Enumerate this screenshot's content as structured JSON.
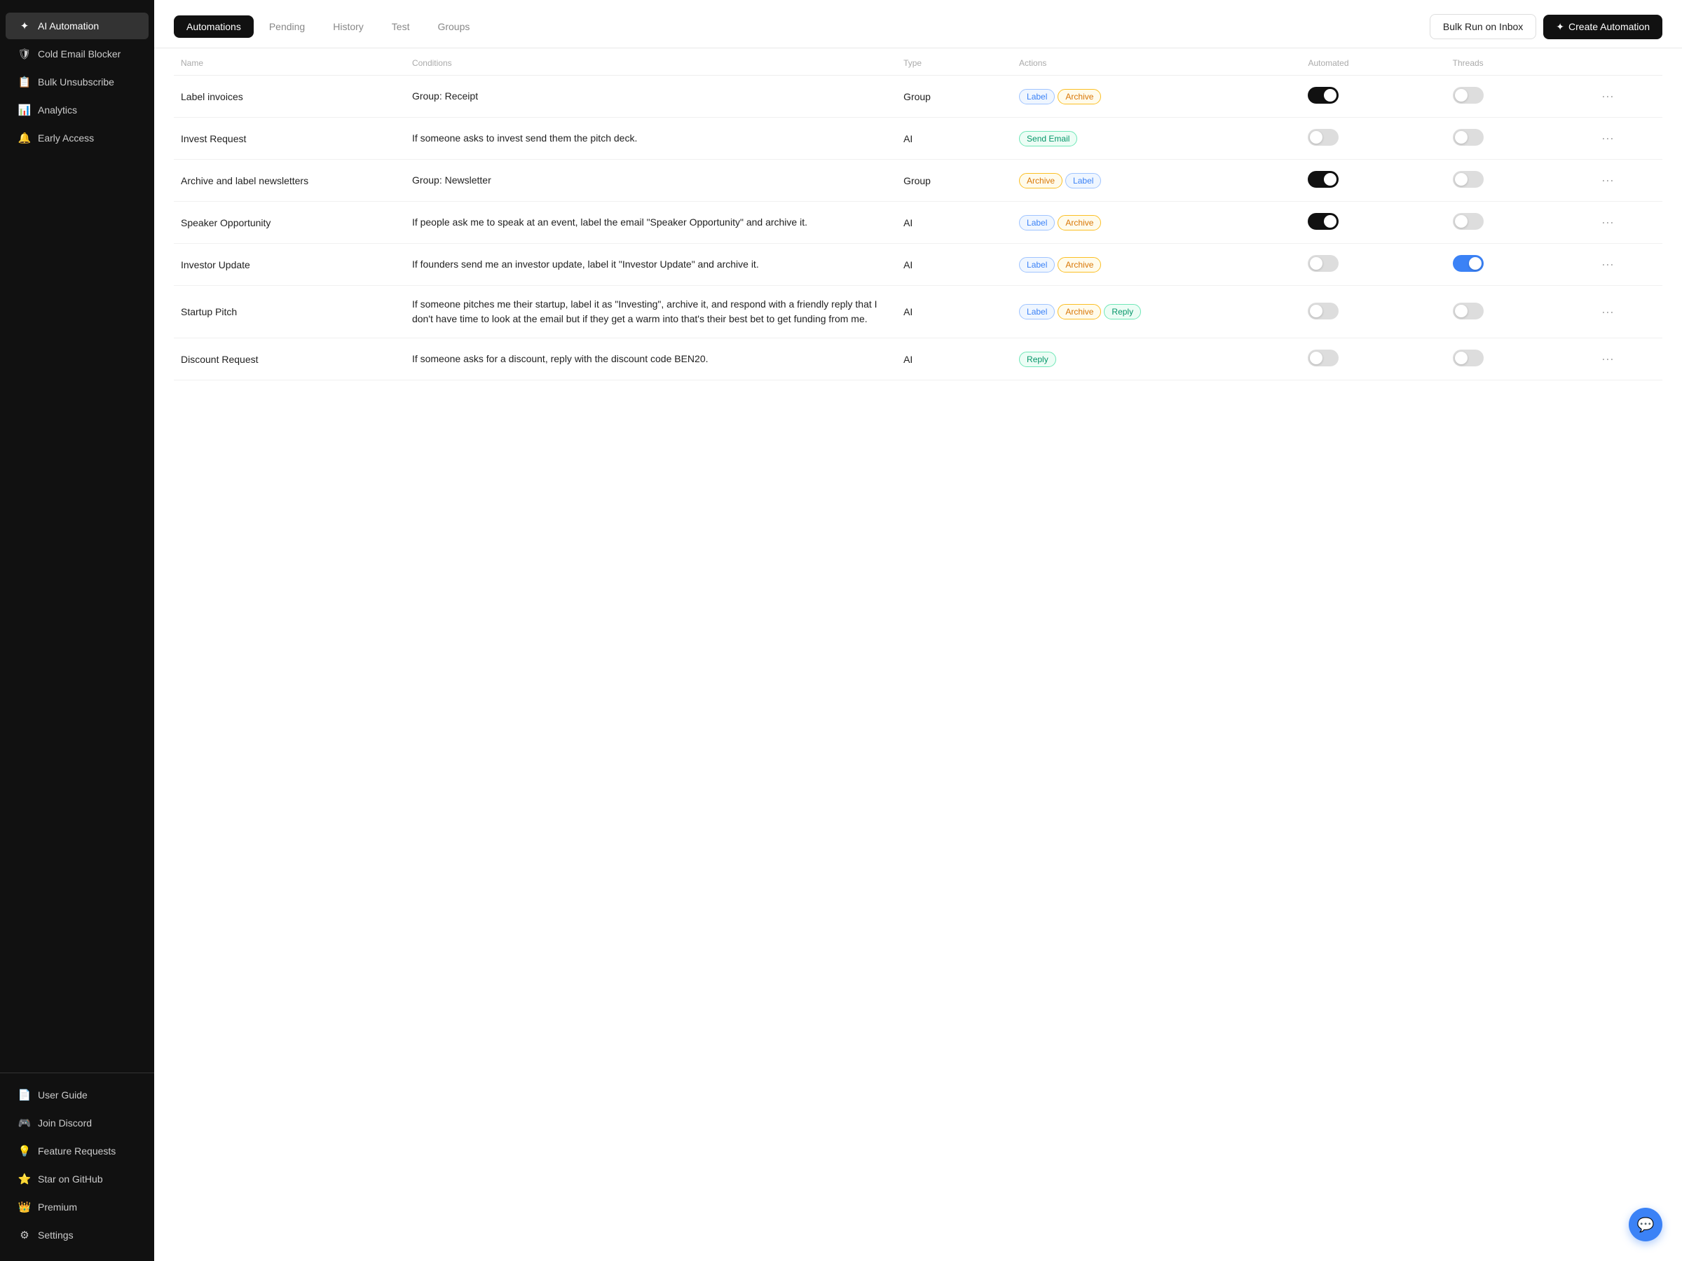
{
  "sidebar": {
    "items": [
      {
        "id": "ai-automation",
        "label": "AI Automation",
        "icon": "✦",
        "active": true
      },
      {
        "id": "cold-email-blocker",
        "label": "Cold Email Blocker",
        "icon": "🛡"
      },
      {
        "id": "bulk-unsubscribe",
        "label": "Bulk Unsubscribe",
        "icon": "📋"
      },
      {
        "id": "analytics",
        "label": "Analytics",
        "icon": "📊"
      },
      {
        "id": "early-access",
        "label": "Early Access",
        "icon": "🔔"
      }
    ],
    "bottom_items": [
      {
        "id": "user-guide",
        "label": "User Guide",
        "icon": "📄"
      },
      {
        "id": "join-discord",
        "label": "Join Discord",
        "icon": "🎮"
      },
      {
        "id": "feature-requests",
        "label": "Feature Requests",
        "icon": "💡"
      },
      {
        "id": "star-github",
        "label": "Star on GitHub",
        "icon": "⭐"
      },
      {
        "id": "premium",
        "label": "Premium",
        "icon": "👑"
      },
      {
        "id": "settings",
        "label": "Settings",
        "icon": "⚙"
      }
    ]
  },
  "tabs": [
    "Automations",
    "Pending",
    "History",
    "Test",
    "Groups"
  ],
  "active_tab": "Automations",
  "buttons": {
    "bulk_run": "Bulk Run on Inbox",
    "create": "Create Automation"
  },
  "table": {
    "headers": [
      "Name",
      "Conditions",
      "Type",
      "Actions",
      "Automated",
      "Threads"
    ],
    "rows": [
      {
        "name": "Label invoices",
        "conditions": "Group: Receipt",
        "type": "Group",
        "actions": [
          {
            "label": "Label",
            "type": "label"
          },
          {
            "label": "Archive",
            "type": "archive"
          }
        ],
        "automated_on": true,
        "threads_on": false
      },
      {
        "name": "Invest Request",
        "conditions": "If someone asks to invest send them the pitch deck.",
        "type": "AI",
        "actions": [
          {
            "label": "Send Email",
            "type": "send-email"
          }
        ],
        "automated_on": false,
        "threads_on": false
      },
      {
        "name": "Archive and label newsletters",
        "conditions": "Group: Newsletter",
        "type": "Group",
        "actions": [
          {
            "label": "Archive",
            "type": "archive"
          },
          {
            "label": "Label",
            "type": "label"
          }
        ],
        "automated_on": true,
        "threads_on": false
      },
      {
        "name": "Speaker Opportunity",
        "conditions": "If people ask me to speak at an event, label the email \"Speaker Opportunity\" and archive it.",
        "type": "AI",
        "actions": [
          {
            "label": "Label",
            "type": "label"
          },
          {
            "label": "Archive",
            "type": "archive"
          }
        ],
        "automated_on": true,
        "threads_on": false
      },
      {
        "name": "Investor Update",
        "conditions": "If founders send me an investor update, label it \"Investor Update\" and archive it.",
        "type": "AI",
        "actions": [
          {
            "label": "Label",
            "type": "label"
          },
          {
            "label": "Archive",
            "type": "archive"
          }
        ],
        "automated_on": false,
        "threads_on": true
      },
      {
        "name": "Startup Pitch",
        "conditions": "If someone pitches me their startup, label it as \"Investing\", archive it, and respond with a friendly reply that I don't have time to look at the email but if they get a warm into that's their best bet to get funding from me.",
        "type": "AI",
        "actions": [
          {
            "label": "Label",
            "type": "label"
          },
          {
            "label": "Archive",
            "type": "archive"
          },
          {
            "label": "Reply",
            "type": "reply"
          }
        ],
        "automated_on": false,
        "threads_on": false
      },
      {
        "name": "Discount Request",
        "conditions": "If someone asks for a discount, reply with the discount code BEN20.",
        "type": "AI",
        "actions": [
          {
            "label": "Reply",
            "type": "reply"
          }
        ],
        "automated_on": false,
        "threads_on": false
      }
    ]
  }
}
